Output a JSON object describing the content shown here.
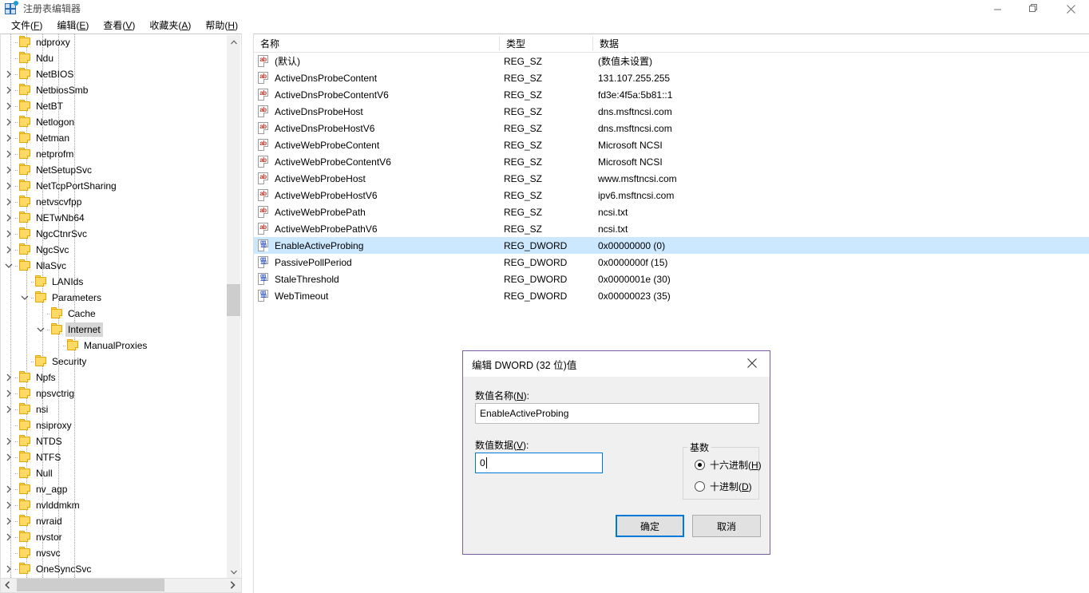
{
  "window": {
    "title": "注册表编辑器",
    "icon": "registry-editor-icon",
    "minimize_label": "最小化",
    "maximize_label": "最大化",
    "close_label": "关闭"
  },
  "menubar": {
    "items": [
      {
        "label": "文件(F)",
        "key": "F"
      },
      {
        "label": "编辑(E)",
        "key": "E"
      },
      {
        "label": "查看(V)",
        "key": "V"
      },
      {
        "label": "收藏夹(A)",
        "key": "A"
      },
      {
        "label": "帮助(H)",
        "key": "H"
      }
    ]
  },
  "tree": {
    "selected": "Internet",
    "items": [
      {
        "label": "ndproxy",
        "depth": 1,
        "chev": "none",
        "selected": false
      },
      {
        "label": "Ndu",
        "depth": 1,
        "chev": "none",
        "selected": false
      },
      {
        "label": "NetBIOS",
        "depth": 1,
        "chev": "collapsed",
        "selected": false
      },
      {
        "label": "NetbiosSmb",
        "depth": 1,
        "chev": "collapsed",
        "selected": false
      },
      {
        "label": "NetBT",
        "depth": 1,
        "chev": "collapsed",
        "selected": false
      },
      {
        "label": "Netlogon",
        "depth": 1,
        "chev": "collapsed",
        "selected": false
      },
      {
        "label": "Netman",
        "depth": 1,
        "chev": "collapsed",
        "selected": false
      },
      {
        "label": "netprofm",
        "depth": 1,
        "chev": "collapsed",
        "selected": false
      },
      {
        "label": "NetSetupSvc",
        "depth": 1,
        "chev": "collapsed",
        "selected": false
      },
      {
        "label": "NetTcpPortSharing",
        "depth": 1,
        "chev": "collapsed",
        "selected": false
      },
      {
        "label": "netvscvfpp",
        "depth": 1,
        "chev": "collapsed",
        "selected": false
      },
      {
        "label": "NETwNb64",
        "depth": 1,
        "chev": "collapsed",
        "selected": false
      },
      {
        "label": "NgcCtnrSvc",
        "depth": 1,
        "chev": "collapsed",
        "selected": false
      },
      {
        "label": "NgcSvc",
        "depth": 1,
        "chev": "collapsed",
        "selected": false
      },
      {
        "label": "NlaSvc",
        "depth": 1,
        "chev": "expanded",
        "selected": false
      },
      {
        "label": "LANIds",
        "depth": 2,
        "chev": "none",
        "selected": false
      },
      {
        "label": "Parameters",
        "depth": 2,
        "chev": "expanded",
        "selected": false
      },
      {
        "label": "Cache",
        "depth": 3,
        "chev": "none",
        "selected": false
      },
      {
        "label": "Internet",
        "depth": 3,
        "chev": "expanded",
        "selected": true
      },
      {
        "label": "ManualProxies",
        "depth": 4,
        "chev": "none",
        "selected": false
      },
      {
        "label": "Security",
        "depth": 2,
        "chev": "none",
        "selected": false
      },
      {
        "label": "Npfs",
        "depth": 1,
        "chev": "collapsed",
        "selected": false
      },
      {
        "label": "npsvctrig",
        "depth": 1,
        "chev": "collapsed",
        "selected": false
      },
      {
        "label": "nsi",
        "depth": 1,
        "chev": "collapsed",
        "selected": false
      },
      {
        "label": "nsiproxy",
        "depth": 1,
        "chev": "none",
        "selected": false
      },
      {
        "label": "NTDS",
        "depth": 1,
        "chev": "collapsed",
        "selected": false
      },
      {
        "label": "NTFS",
        "depth": 1,
        "chev": "collapsed",
        "selected": false
      },
      {
        "label": "Null",
        "depth": 1,
        "chev": "none",
        "selected": false
      },
      {
        "label": "nv_agp",
        "depth": 1,
        "chev": "collapsed",
        "selected": false
      },
      {
        "label": "nvlddmkm",
        "depth": 1,
        "chev": "collapsed",
        "selected": false
      },
      {
        "label": "nvraid",
        "depth": 1,
        "chev": "collapsed",
        "selected": false
      },
      {
        "label": "nvstor",
        "depth": 1,
        "chev": "collapsed",
        "selected": false
      },
      {
        "label": "nvsvc",
        "depth": 1,
        "chev": "none",
        "selected": false
      },
      {
        "label": "OneSyncSvc",
        "depth": 1,
        "chev": "collapsed",
        "selected": false
      }
    ]
  },
  "list": {
    "columns": [
      "名称",
      "类型",
      "数据"
    ],
    "rows": [
      {
        "name": "(默认)",
        "type": "REG_SZ",
        "data": "(数值未设置)",
        "icon": "string-value-icon",
        "selected": false
      },
      {
        "name": "ActiveDnsProbeContent",
        "type": "REG_SZ",
        "data": "131.107.255.255",
        "icon": "string-value-icon",
        "selected": false
      },
      {
        "name": "ActiveDnsProbeContentV6",
        "type": "REG_SZ",
        "data": "fd3e:4f5a:5b81::1",
        "icon": "string-value-icon",
        "selected": false
      },
      {
        "name": "ActiveDnsProbeHost",
        "type": "REG_SZ",
        "data": "dns.msftncsi.com",
        "icon": "string-value-icon",
        "selected": false
      },
      {
        "name": "ActiveDnsProbeHostV6",
        "type": "REG_SZ",
        "data": "dns.msftncsi.com",
        "icon": "string-value-icon",
        "selected": false
      },
      {
        "name": "ActiveWebProbeContent",
        "type": "REG_SZ",
        "data": "Microsoft NCSI",
        "icon": "string-value-icon",
        "selected": false
      },
      {
        "name": "ActiveWebProbeContentV6",
        "type": "REG_SZ",
        "data": "Microsoft NCSI",
        "icon": "string-value-icon",
        "selected": false
      },
      {
        "name": "ActiveWebProbeHost",
        "type": "REG_SZ",
        "data": "www.msftncsi.com",
        "icon": "string-value-icon",
        "selected": false
      },
      {
        "name": "ActiveWebProbeHostV6",
        "type": "REG_SZ",
        "data": "ipv6.msftncsi.com",
        "icon": "string-value-icon",
        "selected": false
      },
      {
        "name": "ActiveWebProbePath",
        "type": "REG_SZ",
        "data": "ncsi.txt",
        "icon": "string-value-icon",
        "selected": false
      },
      {
        "name": "ActiveWebProbePathV6",
        "type": "REG_SZ",
        "data": "ncsi.txt",
        "icon": "string-value-icon",
        "selected": false
      },
      {
        "name": "EnableActiveProbing",
        "type": "REG_DWORD",
        "data": "0x00000000 (0)",
        "icon": "dword-value-icon",
        "selected": true
      },
      {
        "name": "PassivePollPeriod",
        "type": "REG_DWORD",
        "data": "0x0000000f (15)",
        "icon": "dword-value-icon",
        "selected": false
      },
      {
        "name": "StaleThreshold",
        "type": "REG_DWORD",
        "data": "0x0000001e (30)",
        "icon": "dword-value-icon",
        "selected": false
      },
      {
        "name": "WebTimeout",
        "type": "REG_DWORD",
        "data": "0x00000023 (35)",
        "icon": "dword-value-icon",
        "selected": false
      }
    ]
  },
  "dialog": {
    "title": "编辑 DWORD (32 位)值",
    "close_label": "关闭",
    "value_name_label": "数值名称(N):",
    "value_name": "EnableActiveProbing",
    "value_data_label": "数值数据(V):",
    "value_data": "0",
    "base_group_label": "基数",
    "radio_hex_label": "十六进制(H)",
    "radio_dec_label": "十进制(D)",
    "base_selected": "hex",
    "ok_label": "确定",
    "cancel_label": "取消"
  },
  "colors": {
    "selection": "#cce8ff",
    "tree_selection": "#d6d6d6",
    "dialog_border": "#7a5c9e",
    "accent": "#0078d7",
    "folder": "#ffd966"
  }
}
